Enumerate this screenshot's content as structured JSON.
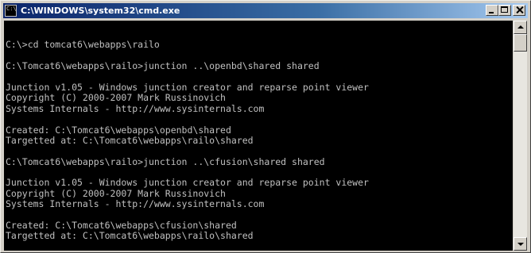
{
  "window": {
    "title": "C:\\WINDOWS\\system32\\cmd.exe",
    "icon": "C:\\",
    "buttons": {
      "minimize_icon": "minimize-icon",
      "maximize_icon": "maximize-icon",
      "close_icon": "close-icon"
    }
  },
  "console": {
    "background": "#000000",
    "foreground": "#c0c0c0",
    "lines": [
      "",
      "C:\\>cd tomcat6\\webapps\\railo",
      "",
      "C:\\Tomcat6\\webapps\\railo>junction ..\\openbd\\shared shared",
      "",
      "Junction v1.05 - Windows junction creator and reparse point viewer",
      "Copyright (C) 2000-2007 Mark Russinovich",
      "Systems Internals - http://www.sysinternals.com",
      "",
      "Created: C:\\Tomcat6\\webapps\\openbd\\shared",
      "Targetted at: C:\\Tomcat6\\webapps\\railo\\shared",
      "",
      "C:\\Tomcat6\\webapps\\railo>junction ..\\cfusion\\shared shared",
      "",
      "Junction v1.05 - Windows junction creator and reparse point viewer",
      "Copyright (C) 2000-2007 Mark Russinovich",
      "Systems Internals - http://www.sysinternals.com",
      "",
      "Created: C:\\Tomcat6\\webapps\\cfusion\\shared",
      "Targetted at: C:\\Tomcat6\\webapps\\railo\\shared",
      ""
    ],
    "prompt": "C:\\Tomcat6\\webapps\\railo>"
  },
  "scrollbar": {
    "up_icon": "scroll-up-arrow-icon",
    "down_icon": "scroll-down-arrow-icon"
  }
}
